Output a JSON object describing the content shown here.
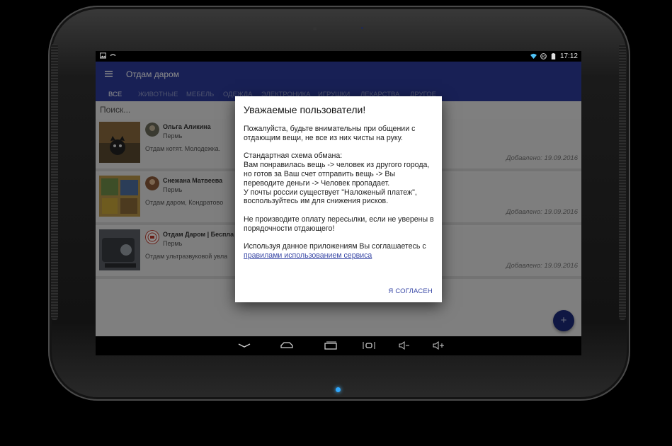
{
  "status_bar": {
    "time": "17:12",
    "icons": [
      "image-icon",
      "usb-icon",
      "wifi-icon",
      "data-icon",
      "battery-icon"
    ]
  },
  "app_bar": {
    "title": "Отдам даром",
    "tabs": [
      "ВСЕ",
      "ЖИВОТНЫЕ",
      "МЕБЕЛЬ",
      "ОДЕЖДА",
      "ЭЛЕКТРОНИКА",
      "ИГРУШКИ",
      "ЛЕКАРСТВА",
      "ДРУГОЕ"
    ],
    "active_tab": "ВСЕ"
  },
  "search": {
    "placeholder": "Поиск..."
  },
  "listings": [
    {
      "name": "Ольга Аликина",
      "city": "Пермь",
      "description": "Отдам котят. Молодежка.",
      "date": "Добавлено: 19.09.2016"
    },
    {
      "name": "Снежана Матвеева",
      "city": "Пермь",
      "description": "Отдам даром, Кондратово",
      "date": "Добавлено: 19.09.2016"
    },
    {
      "name": "Отдам Даром | Беспла",
      "city": "Пермь",
      "description": "Отдам ультразвуковой увла",
      "date": "Добавлено: 19.09.2016"
    }
  ],
  "fab": {
    "label": "+"
  },
  "dialog": {
    "title": "Уважаемые пользователи!",
    "p1": "Пожалуйста, будьте внимательны при общении с отдающим вещи, не все из них чисты на руку.",
    "p2_line1": "Стандартная схема обмана:",
    "p2_rest": "Вам понравилась вещь -> человек из другого города, но готов за Ваш счет отправить вещь -> Вы переводите деньги -> Человек пропадает.",
    "p2_post": "У почты россии существует \"Наложеный платеж\", воспользуйтесь им для снижения рисков.",
    "p3": "Не производите оплату пересылки, если не уверены в порядочности отдающего!",
    "p4_prefix": "Используя данное приложениям Вы соглашаетесь с ",
    "p4_link": "правилами использованием сервиса",
    "button": "Я СОГЛАСЕН"
  },
  "colors": {
    "app_bar": "#2c3b9c",
    "accent": "#3b4aa7",
    "fab": "#1c2a7a"
  }
}
